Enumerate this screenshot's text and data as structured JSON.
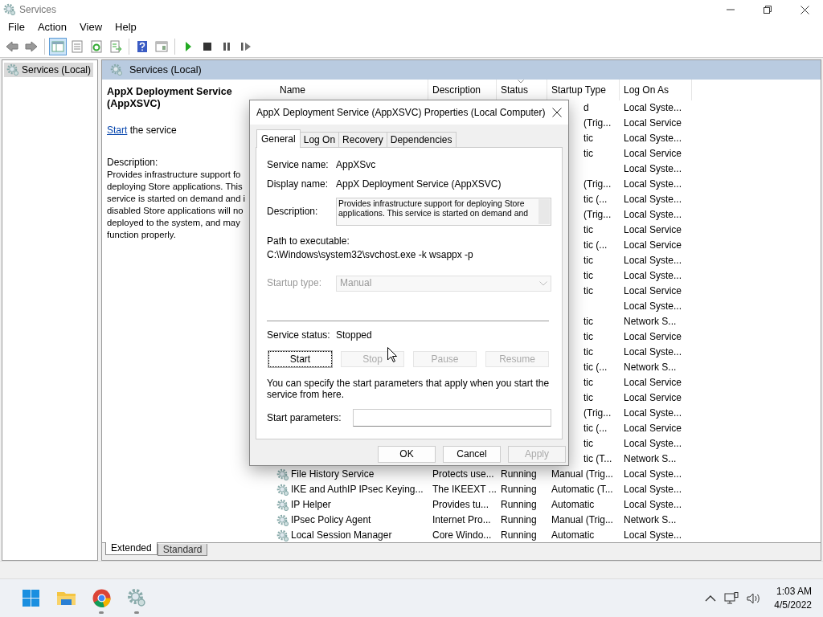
{
  "window": {
    "title": "Services"
  },
  "menu": [
    "File",
    "Action",
    "View",
    "Help"
  ],
  "toolbar": [
    [
      {
        "kind": "back",
        "pressed": false
      },
      {
        "kind": "forward",
        "pressed": false
      }
    ],
    [
      {
        "kind": "tree",
        "pressed": true
      },
      {
        "kind": "properties",
        "pressed": false
      },
      {
        "kind": "refresh",
        "pressed": false
      },
      {
        "kind": "export",
        "pressed": false
      }
    ],
    [
      {
        "kind": "help",
        "pressed": false
      },
      {
        "kind": "view",
        "pressed": false
      }
    ],
    [
      {
        "kind": "play",
        "pressed": false
      },
      {
        "kind": "stop",
        "pressed": false
      },
      {
        "kind": "pause",
        "pressed": false
      },
      {
        "kind": "resume",
        "pressed": false
      }
    ]
  ],
  "tree": [
    {
      "label": "Services (Local)",
      "selected": true
    }
  ],
  "pane_header": "Services (Local)",
  "details": {
    "title": "AppX Deployment Service (AppXSVC)",
    "link": "Start",
    "link_rest": " the service",
    "description_label": "Description:",
    "description_lines": [
      "Provides infrastructure support fo",
      "deploying Store applications. This",
      "service is started on demand and i",
      "disabled Store applications will no",
      "deployed to the system, and may",
      "function properly."
    ]
  },
  "table": {
    "columns": [
      {
        "label": "Name",
        "sorted": false
      },
      {
        "label": "Description",
        "sorted": false
      },
      {
        "label": "Status",
        "sorted": true
      },
      {
        "label": "Startup Type",
        "sorted": false
      },
      {
        "label": "Log On As",
        "sorted": false
      }
    ],
    "rows": [
      {
        "kind": "covered",
        "startup_type": "d",
        "log_on_as": "Local Syste..."
      },
      {
        "kind": "covered",
        "startup_type": "(Trig...",
        "log_on_as": "Local Service"
      },
      {
        "kind": "covered",
        "startup_type": "tic",
        "log_on_as": "Local Syste..."
      },
      {
        "kind": "covered",
        "startup_type": "tic",
        "log_on_as": "Local Service"
      },
      {
        "kind": "covered",
        "log_on_as": "Local Syste..."
      },
      {
        "kind": "covered",
        "startup_type": "(Trig...",
        "log_on_as": "Local Syste..."
      },
      {
        "kind": "covered",
        "startup_type": "tic (...",
        "log_on_as": "Local Syste..."
      },
      {
        "kind": "covered",
        "startup_type": "(Trig...",
        "log_on_as": "Local Syste..."
      },
      {
        "kind": "covered",
        "startup_type": "tic",
        "log_on_as": "Local Service"
      },
      {
        "kind": "covered",
        "startup_type": "tic (...",
        "log_on_as": "Local Service"
      },
      {
        "kind": "covered",
        "startup_type": "tic",
        "log_on_as": "Local Syste..."
      },
      {
        "kind": "covered",
        "startup_type": "tic",
        "log_on_as": "Local Syste..."
      },
      {
        "kind": "covered",
        "startup_type": "tic",
        "log_on_as": "Local Service"
      },
      {
        "kind": "covered",
        "log_on_as": "Local Syste..."
      },
      {
        "kind": "covered",
        "startup_type": "tic",
        "log_on_as": "Network S..."
      },
      {
        "kind": "covered",
        "startup_type": "tic",
        "log_on_as": "Local Service"
      },
      {
        "kind": "covered",
        "startup_type": "tic",
        "log_on_as": "Local Syste..."
      },
      {
        "kind": "covered",
        "startup_type": "tic (...",
        "log_on_as": "Network S..."
      },
      {
        "kind": "covered",
        "startup_type": "tic",
        "log_on_as": "Local Service"
      },
      {
        "kind": "covered",
        "startup_type": "tic",
        "log_on_as": "Local Service"
      },
      {
        "kind": "covered",
        "startup_type": "(Trig...",
        "log_on_as": "Local Syste..."
      },
      {
        "kind": "covered",
        "startup_type": "tic (...",
        "log_on_as": "Local Service"
      },
      {
        "kind": "covered",
        "startup_type": "tic",
        "log_on_as": "Local Syste..."
      },
      {
        "kind": "covered",
        "startup_type": "tic (T...",
        "log_on_as": "Network S..."
      },
      {
        "kind": "full",
        "name": "File History Service",
        "description": "Protects use...",
        "status": "Running",
        "startup_type": "Manual (Trig...",
        "log_on_as": "Local Syste..."
      },
      {
        "kind": "full",
        "name": "IKE and AuthIP IPsec Keying...",
        "description": "The IKEEXT ...",
        "status": "Running",
        "startup_type": "Automatic (T...",
        "log_on_as": "Local Syste..."
      },
      {
        "kind": "full",
        "name": "IP Helper",
        "description": "Provides tu...",
        "status": "Running",
        "startup_type": "Automatic",
        "log_on_as": "Local Syste..."
      },
      {
        "kind": "full",
        "name": "IPsec Policy Agent",
        "description": "Internet Pro...",
        "status": "Running",
        "startup_type": "Manual (Trig...",
        "log_on_as": "Network S..."
      },
      {
        "kind": "full",
        "name": "Local Session Manager",
        "description": "Core Windo...",
        "status": "Running",
        "startup_type": "Automatic",
        "log_on_as": "Local Syste..."
      }
    ]
  },
  "view_tabs": [
    {
      "label": "Extended",
      "selected": true
    },
    {
      "label": "Standard",
      "selected": false
    }
  ],
  "dialog": {
    "title": "AppX Deployment Service (AppXSVC) Properties (Local Computer)",
    "tabs": [
      {
        "label": "General",
        "selected": true
      },
      {
        "label": "Log On",
        "selected": false
      },
      {
        "label": "Recovery",
        "selected": false
      },
      {
        "label": "Dependencies",
        "selected": false
      }
    ],
    "service_name_label": "Service name:",
    "service_name": "AppXSvc",
    "display_name_label": "Display name:",
    "display_name": "AppX Deployment Service (AppXSVC)",
    "description_label": "Description:",
    "description_lines": [
      "Provides infrastructure support for deploying Store",
      "applications. This service is started on demand and"
    ],
    "path_label": "Path to executable:",
    "path": "C:\\Windows\\system32\\svchost.exe -k wsappx -p",
    "startup_type_label": "Startup type:",
    "startup_type": "Manual",
    "startup_type_disabled": true,
    "status_label": "Service status:",
    "status": "Stopped",
    "service_buttons": [
      {
        "label": "Start",
        "disabled": false
      },
      {
        "label": "Stop",
        "disabled": true
      },
      {
        "label": "Pause",
        "disabled": true
      },
      {
        "label": "Resume",
        "disabled": true
      }
    ],
    "help_text": "You can specify the start parameters that apply when you start the service from here.",
    "params_label": "Start parameters:",
    "footer_buttons": [
      {
        "label": "OK",
        "disabled": false
      },
      {
        "label": "Cancel",
        "disabled": false
      },
      {
        "label": "Apply",
        "disabled": true
      }
    ]
  },
  "taskbar": {
    "apps": [
      {
        "kind": "start",
        "running": false
      },
      {
        "kind": "folder",
        "running": false
      },
      {
        "kind": "browser",
        "running": true
      },
      {
        "kind": "services",
        "running": true
      }
    ],
    "time": "1:03 AM",
    "date": "4/5/2022"
  }
}
